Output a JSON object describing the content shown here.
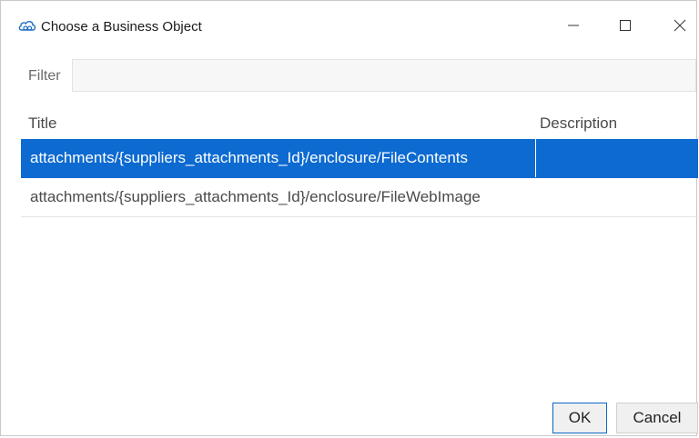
{
  "window": {
    "title": "Choose a Business Object",
    "icon": "cloud-link-icon"
  },
  "filter": {
    "label": "Filter",
    "value": "",
    "placeholder": ""
  },
  "table": {
    "columns": [
      "Title",
      "Description"
    ],
    "rows": [
      {
        "title": "attachments/{suppliers_attachments_Id}/enclosure/FileContents",
        "description": "",
        "selected": true
      },
      {
        "title": "attachments/{suppliers_attachments_Id}/enclosure/FileWebImage",
        "description": "",
        "selected": false
      }
    ]
  },
  "buttons": {
    "ok": "OK",
    "cancel": "Cancel"
  },
  "colors": {
    "selection": "#0c6ad1",
    "ok_border": "#0a64c8"
  }
}
